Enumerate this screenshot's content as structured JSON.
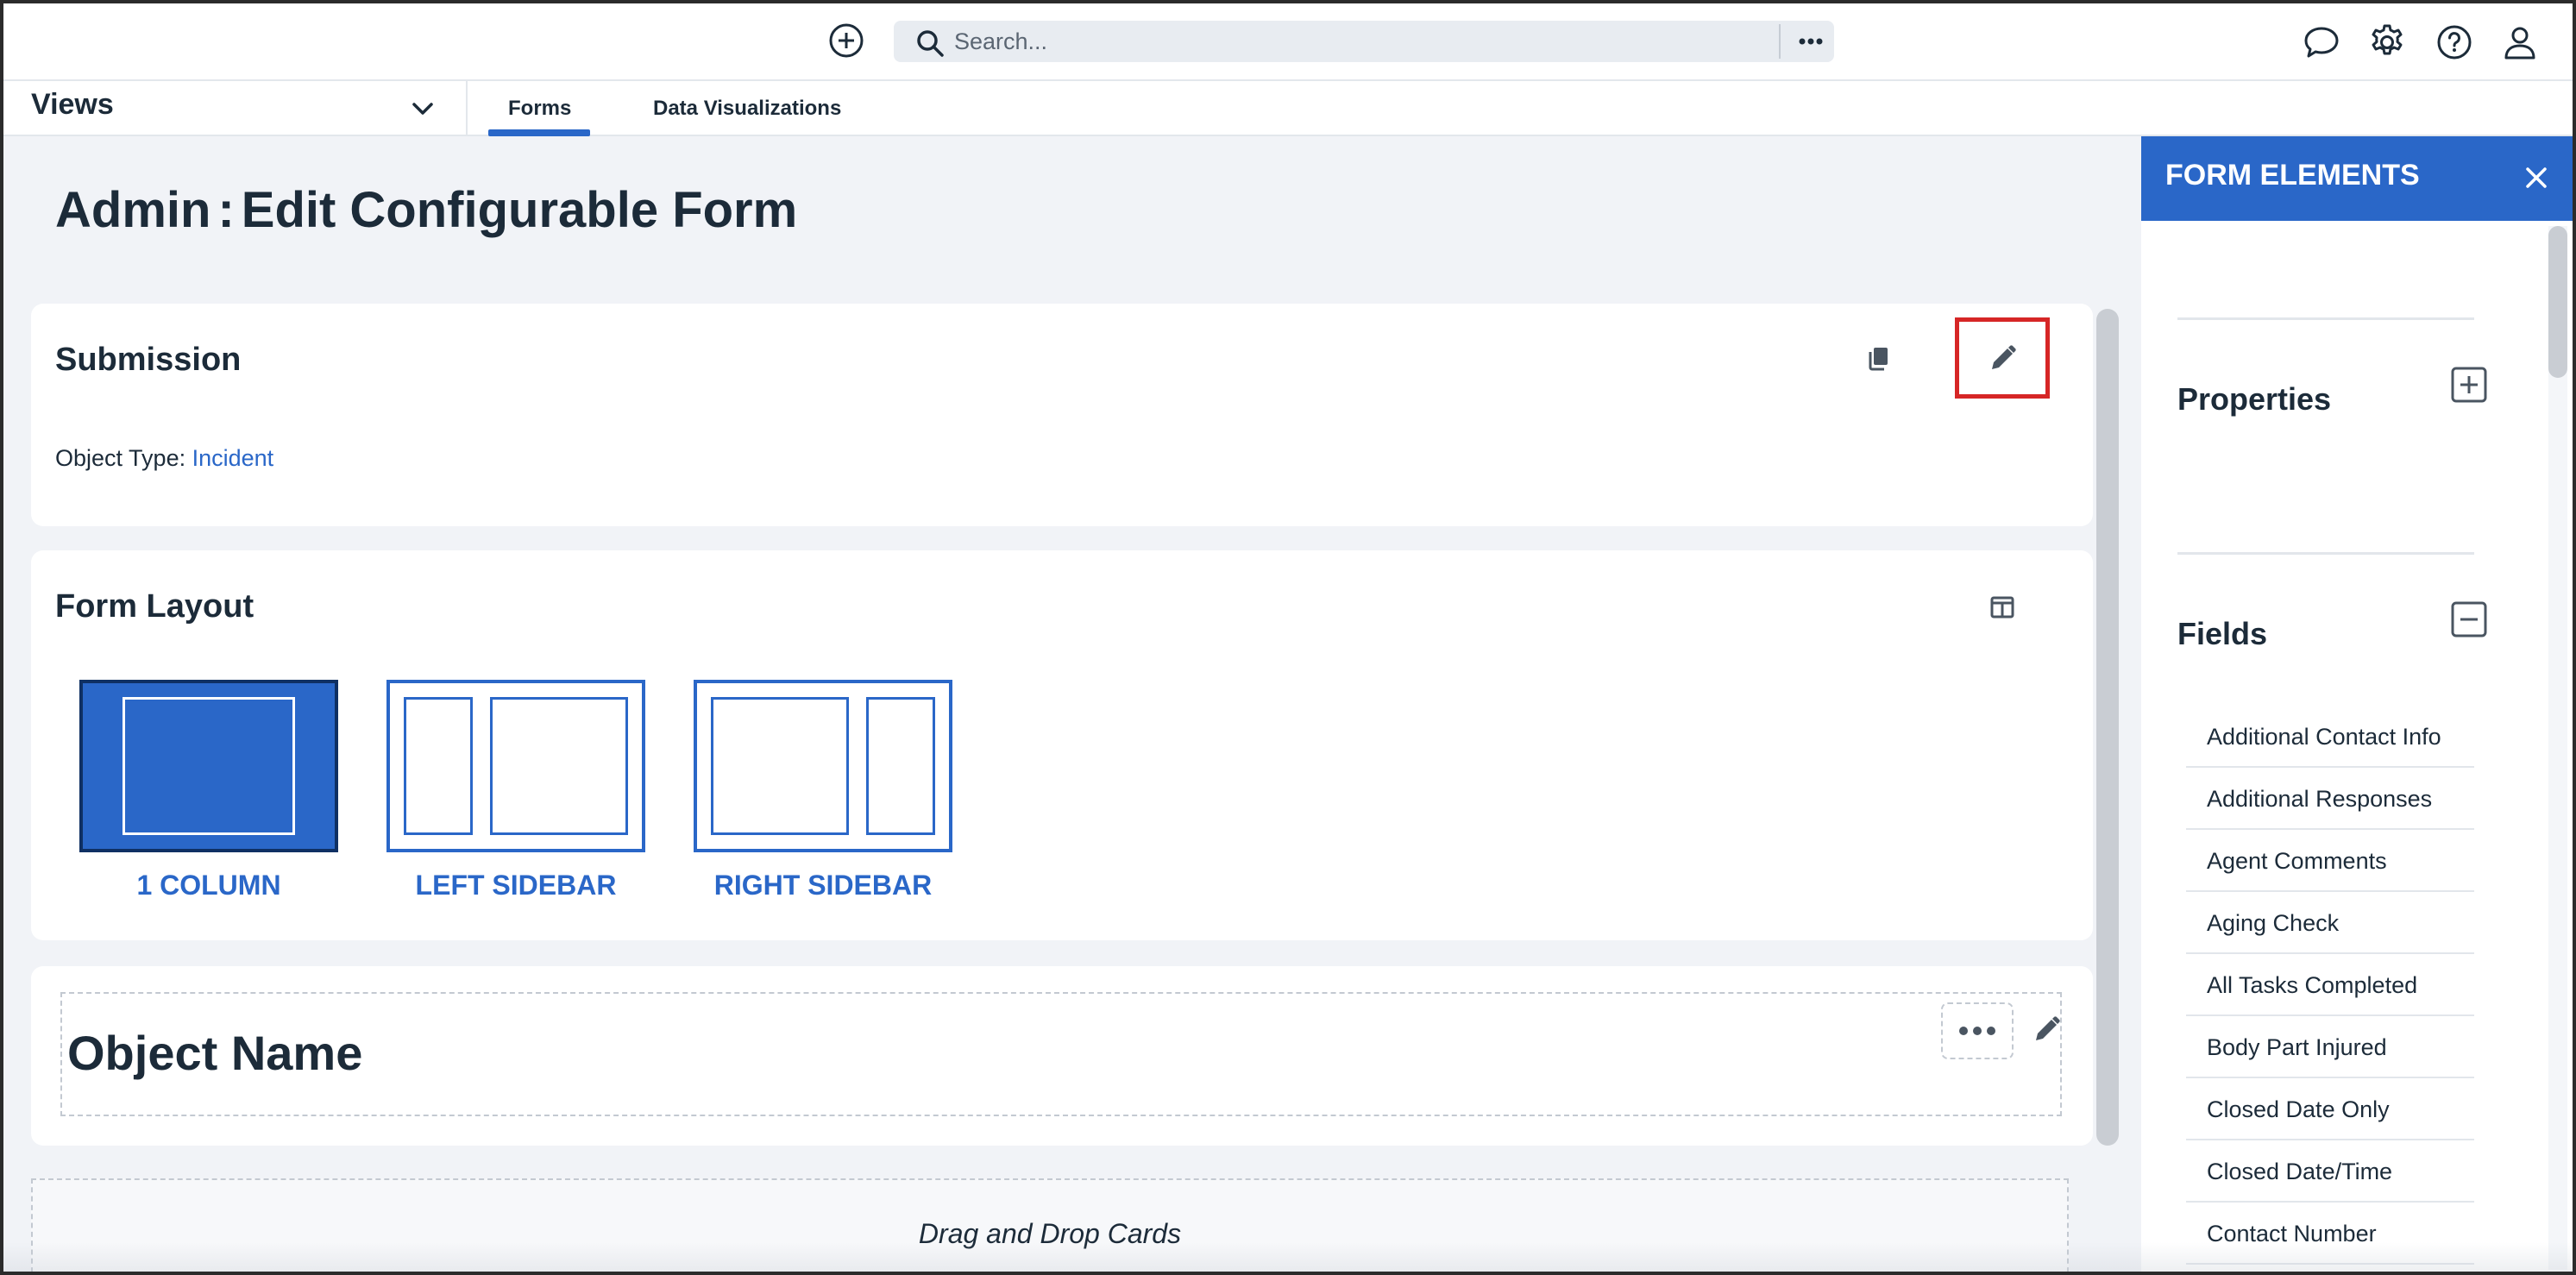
{
  "topbar": {
    "search_placeholder": "Search..."
  },
  "nav": {
    "views_label": "Views",
    "tabs": [
      {
        "label": "Forms",
        "active": true
      },
      {
        "label": "Data Visualizations",
        "active": false
      }
    ]
  },
  "page": {
    "title_prefix": "Admin",
    "title_separator": ":",
    "title_main": "Edit Configurable Form"
  },
  "submission_card": {
    "title": "Submission",
    "object_type_label": "Object Type:",
    "object_type_value": "Incident"
  },
  "layout_card": {
    "title": "Form Layout",
    "options": [
      {
        "label": "1 COLUMN",
        "selected": true
      },
      {
        "label": "LEFT SIDEBAR",
        "selected": false
      },
      {
        "label": "RIGHT SIDEBAR",
        "selected": false
      }
    ]
  },
  "object_card": {
    "name": "Object Name"
  },
  "drop_zone": {
    "text": "Drag and Drop Cards"
  },
  "panel": {
    "title": "FORM ELEMENTS",
    "sections": {
      "properties": "Properties",
      "fields": "Fields"
    },
    "fields": [
      "Additional Contact Info",
      "Additional Responses",
      "Agent Comments",
      "Aging Check",
      "All Tasks Completed",
      "Body Part Injured",
      "Closed Date Only",
      "Closed Date/Time",
      "Contact Number"
    ]
  },
  "colors": {
    "accent": "#2a67c8",
    "highlight": "#d62626",
    "text": "#1c2b39",
    "background": "#f1f3f7"
  },
  "icons": [
    "add-circle-icon",
    "search-icon",
    "more-horizontal-icon",
    "chat-icon",
    "gear-icon",
    "help-icon",
    "user-icon",
    "chevron-down-icon",
    "copy-icon",
    "pencil-icon",
    "layout-icon",
    "close-icon",
    "plus-square-icon",
    "minus-square-icon"
  ]
}
